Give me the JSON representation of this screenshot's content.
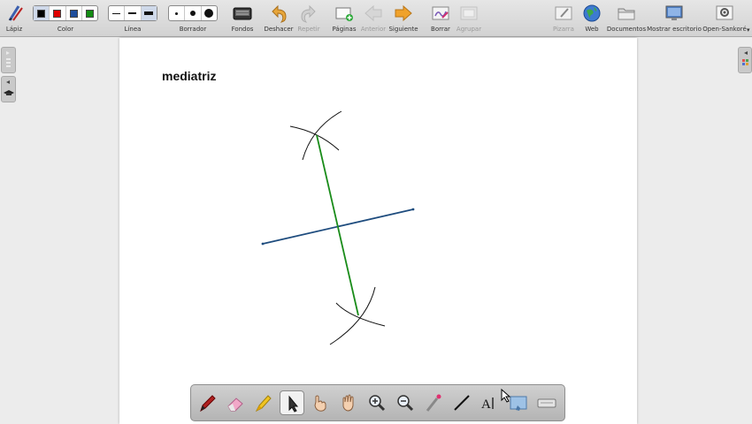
{
  "toolbar": {
    "pencil_label": "Lápiz",
    "color_label": "Color",
    "colors": [
      "#000000",
      "#e00000",
      "#1f4e9c",
      "#138c13"
    ],
    "line_label": "Línea",
    "eraser_label": "Borrador",
    "backgrounds_label": "Fondos",
    "undo_label": "Deshacer",
    "redo_label": "Repetir",
    "pages_label": "Páginas",
    "previous_label": "Anterior",
    "next_label": "Siguiente",
    "clear_label": "Borrar",
    "group_label": "Agrupar",
    "board_label": "Pizarra",
    "web_label": "Web",
    "documents_label": "Documentos",
    "desktop_label": "Mostrar escritorio",
    "app_label": "Open-Sankoré"
  },
  "board": {
    "title": "mediatriz"
  },
  "drawing_colors": {
    "arcs": "#111111",
    "bisector": "#1a8c1a",
    "segment": "#1e4c7e"
  },
  "palette": {
    "tools": [
      "pen-tool",
      "eraser-tool",
      "marker-tool",
      "selector-tool",
      "interact-tool",
      "hand-tool",
      "zoom-in-tool",
      "zoom-out-tool",
      "laser-pointer-tool",
      "line-tool",
      "text-tool",
      "capture-tool",
      "virtual-keyboard-tool"
    ],
    "selected": "selector-tool"
  }
}
